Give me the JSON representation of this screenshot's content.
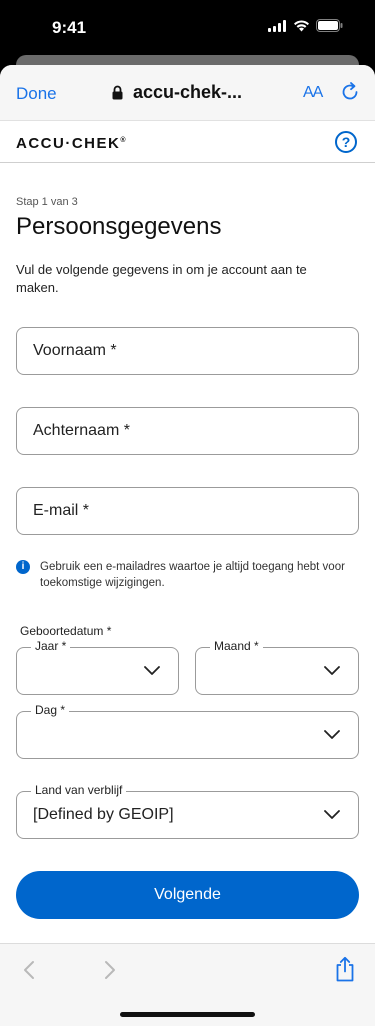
{
  "status_bar": {
    "time": "9:41"
  },
  "browser": {
    "done_label": "Done",
    "url": "accu-chek-...",
    "text_size_label": "AA"
  },
  "site": {
    "logo_text": "ACCU·CHEK",
    "logo_mark": "®",
    "help_label": "?"
  },
  "form": {
    "step": "Stap 1 van 3",
    "title": "Persoonsgegevens",
    "intro": "Vul de volgende gegevens in om je account aan te maken.",
    "first_name_placeholder": "Voornaam *",
    "last_name_placeholder": "Achternaam *",
    "email_placeholder": "E-mail *",
    "email_info": "Gebruik een e-mailadres waartoe je altijd toegang hebt voor toekomstige wijzigingen.",
    "info_icon_glyph": "i",
    "birthdate_label": "Geboortedatum *",
    "year_label": "Jaar *",
    "month_label": "Maand *",
    "day_label": "Dag *",
    "country_label": "Land van verblijf",
    "country_value": "[Defined by GEOIP]",
    "next_button": "Volgende"
  },
  "colors": {
    "accent": "#0066cc",
    "ios_blue": "#1a73e8"
  }
}
